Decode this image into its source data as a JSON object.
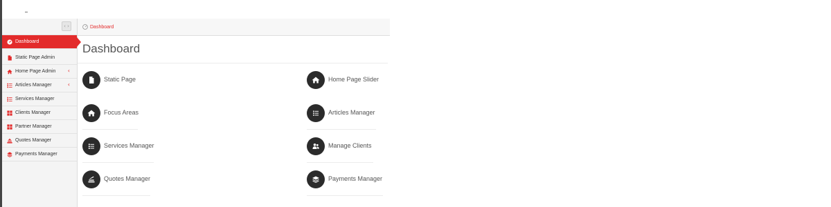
{
  "sidebar": {
    "toggle_glyph": "‹ ›",
    "items": [
      {
        "label": "Dashboard",
        "icon": "dashboard-icon",
        "active": true
      },
      {
        "label": "Static Page Admin",
        "icon": "file-icon"
      },
      {
        "label": "Home Page Admin",
        "icon": "home-icon",
        "has_submenu": true
      },
      {
        "label": "Articles Manager",
        "icon": "list-icon",
        "has_submenu": true
      },
      {
        "label": "Services Manager",
        "icon": "list-icon"
      },
      {
        "label": "Clients Manager",
        "icon": "grid-icon"
      },
      {
        "label": "Partner Manager",
        "icon": "grid-icon"
      },
      {
        "label": "Quotes Manager",
        "icon": "stack-icon"
      },
      {
        "label": "Payments Manager",
        "icon": "layers-icon"
      }
    ],
    "submenu_glyph": "‹"
  },
  "breadcrumb": {
    "label": "Dashboard",
    "icon": "dashboard-icon"
  },
  "main": {
    "title": "Dashboard",
    "tiles": [
      {
        "label": "Static Page",
        "icon": "file-icon"
      },
      {
        "label": "Home Page Slider",
        "icon": "home-icon"
      },
      {
        "label": "Focus Areas",
        "icon": "home-icon"
      },
      {
        "label": "Articles Manager",
        "icon": "list-icon"
      },
      {
        "label": "Services Manager",
        "icon": "list-icon"
      },
      {
        "label": "Manage Clients",
        "icon": "users-icon"
      },
      {
        "label": "Quotes Manager",
        "icon": "stack-icon"
      },
      {
        "label": "Payments Manager",
        "icon": "layers-icon"
      }
    ]
  },
  "colors": {
    "accent": "#e32b2b",
    "icon_circle": "#2b2b2b",
    "sidebar_bg": "#f4f4f4"
  }
}
